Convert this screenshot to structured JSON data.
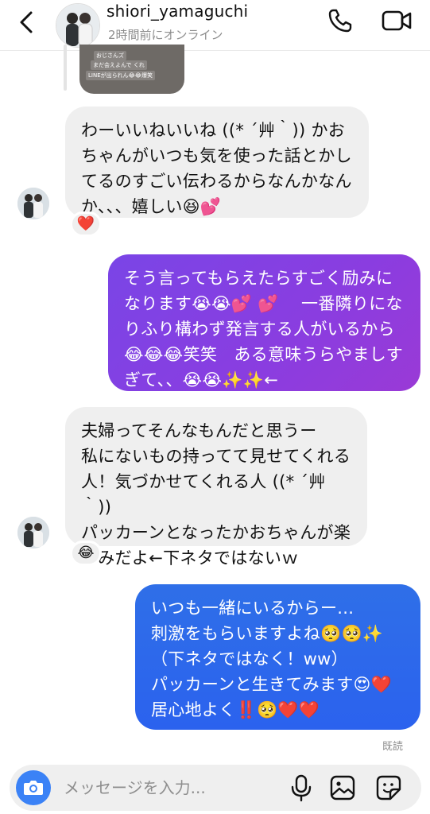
{
  "header": {
    "username": "shiori_yamaguchi",
    "status": "2時間前にオンライン",
    "icons": [
      "back-icon",
      "profile-avatar",
      "phone-icon",
      "video-icon"
    ]
  },
  "shared_image": {
    "line1": "おじさんズ",
    "line2": "まだ会えよんで くれ",
    "line3": "LINEが出られん😂😂爆笑"
  },
  "messages": [
    {
      "side": "incoming",
      "text": "わーいいねいいね ((* ´艸｀)) かおちゃんがいつも気を使った話とかしてるのすごい伝わるからなんかなんか、、、嬉しい😆💕",
      "reaction": "❤️"
    },
    {
      "side": "outgoing",
      "text": "そう言ってもらえたらすごく励みになります😭😭💕 💕　 一番隣りになりふり構わず発言する人がいるから😂😂😂笑笑　ある意味うらやましすぎて、、😭😭✨✨←"
    },
    {
      "side": "incoming",
      "text": "夫婦ってそんなもんだと思うー\n私にないもの持ってて見せてくれる人！気づかせてくれる人 ((* ´艸｀))\nパッカーンとなったかおちゃんが楽しみだよ←下ネタではないｗ",
      "reaction": "😂"
    },
    {
      "side": "outgoing",
      "text": "いつも一緒にいるからー...\n刺激をもらいますよね🥺🥺✨\n（下ネタではなく！ww）\nパッカーンと生きてみます😍❤️\n居心地よく‼️🥺❤️❤️"
    }
  ],
  "seen_label": "既読",
  "composer": {
    "placeholder": "メッセージを入力...",
    "value": ""
  },
  "colors": {
    "outgoing_purple": "#8040E0",
    "outgoing_blue": "#2D68EC",
    "incoming_gray": "#EFEFEF",
    "camera_button": "#3B82F6"
  }
}
